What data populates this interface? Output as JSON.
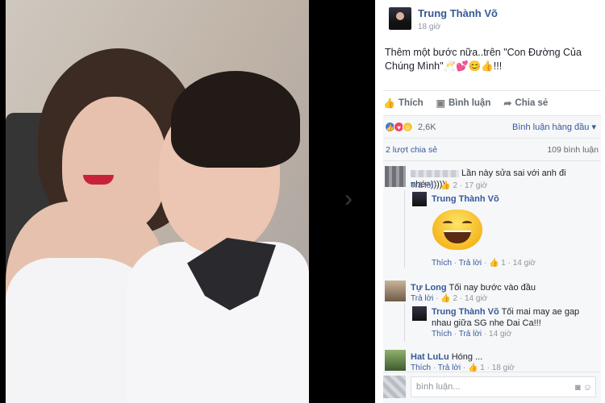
{
  "post": {
    "author": "Trung Thành Võ",
    "time": "18 giờ",
    "text": "Thêm một bước nữa..trên \"Con Đường Của Chúng Mình\"🥂💕😊👍!!!"
  },
  "actions": {
    "like": "Thích",
    "comment": "Bình luận",
    "share": "Chia sẻ"
  },
  "reactions": {
    "count": "2,6K",
    "sort": "Bình luận hàng đầu"
  },
  "stats": {
    "shares": "2 lượt chia sẻ",
    "comments": "109 bình luận"
  },
  "comments": [
    {
      "name": "",
      "text": "Lần này sửa sai với anh đi nhé=)))))",
      "reply": "Trả lời",
      "likes": "2",
      "time": "17 giờ",
      "replies": [
        {
          "name": "Trung Thành Võ",
          "text": "",
          "like": "Thích",
          "reply": "Trả lời",
          "likes": "1",
          "time": "14 giờ"
        }
      ]
    },
    {
      "name": "Tự Long",
      "text": "Tối nay bước vào đầu",
      "reply": "Trả lời",
      "likes": "2",
      "time": "14 giờ",
      "replies": [
        {
          "name": "Trung Thành Võ",
          "text": "Tối mai may ae gap nhau giữa SG nhe Dai Ca!!!",
          "like": "Thích",
          "reply": "Trả lời",
          "time": "14 giờ"
        }
      ]
    },
    {
      "name": "Hat LuLu",
      "text": "Hóng ...",
      "like": "Thích",
      "reply": "Trả lời",
      "likes": "1",
      "time": "18 giờ"
    }
  ],
  "input": {
    "placeholder": "bình luận..."
  },
  "icons": {
    "like": "thumb-up-icon",
    "comment": "speech-bubble-icon",
    "share": "share-arrow-icon"
  }
}
